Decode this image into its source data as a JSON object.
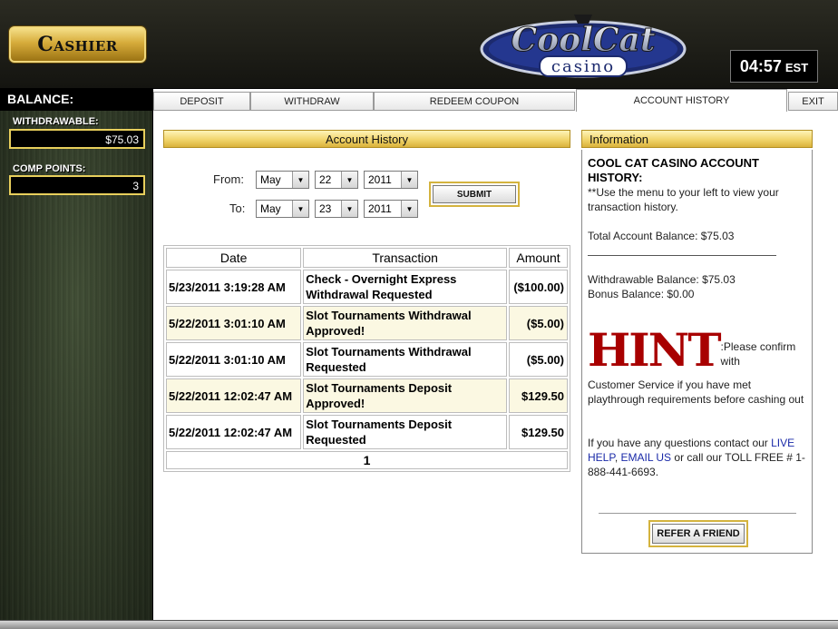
{
  "header": {
    "cashier_label": "Cashier",
    "brand_top": "CoolCat",
    "brand_bottom": "casino",
    "clock_time": "04:57",
    "clock_zone": "EST"
  },
  "sidebar": {
    "balance_label": "BALANCE:",
    "withdrawable_label": "WITHDRAWABLE:",
    "withdrawable_value": "$75.03",
    "comp_points_label": "COMP POINTS:",
    "comp_points_value": "3"
  },
  "tabs": [
    {
      "label": "DEPOSIT"
    },
    {
      "label": "WITHDRAW"
    },
    {
      "label": "REDEEM COUPON"
    },
    {
      "label": "ACCOUNT HISTORY",
      "active": true
    },
    {
      "label": "EXIT"
    }
  ],
  "history": {
    "title": "Account History",
    "from_label": "From:",
    "to_label": "To:",
    "from": {
      "month": "May",
      "day": "22",
      "year": "2011"
    },
    "to": {
      "month": "May",
      "day": "23",
      "year": "2011"
    },
    "submit_label": "SUBMIT",
    "columns": [
      "Date",
      "Transaction",
      "Amount"
    ],
    "rows": [
      {
        "date": "5/23/2011 3:19:28 AM",
        "transaction_l1": "Check - Overnight Express",
        "transaction_l2": "Withdrawal Requested",
        "amount": "($100.00)"
      },
      {
        "date": "5/22/2011 3:01:10 AM",
        "transaction_l1": "Slot Tournaments Withdrawal",
        "transaction_l2": "Approved!",
        "amount": "($5.00)"
      },
      {
        "date": "5/22/2011 3:01:10 AM",
        "transaction_l1": "Slot Tournaments Withdrawal",
        "transaction_l2": "Requested",
        "amount": "($5.00)"
      },
      {
        "date": "5/22/2011 12:02:47 AM",
        "transaction_l1": "Slot Tournaments Deposit",
        "transaction_l2": "Approved!",
        "amount": "$129.50"
      },
      {
        "date": "5/22/2011 12:02:47 AM",
        "transaction_l1": "Slot Tournaments Deposit",
        "transaction_l2": "Requested",
        "amount": "$129.50"
      }
    ],
    "page": "1"
  },
  "info": {
    "title": "Information",
    "heading": "COOL CAT CASINO ACCOUNT HISTORY:",
    "menu_note": "**Use the menu to your left to view your transaction history.",
    "total_balance": "Total Account Balance: $75.03",
    "withdrawable_balance": "Withdrawable Balance: $75.03",
    "bonus_balance": "Bonus Balance: $0.00",
    "hint_word": "HINT",
    "hint_text_1": ":Please confirm with",
    "hint_text_2": "Customer Service if you have met playthrough requirements before cashing out",
    "contact_prefix": "If you have any questions contact our ",
    "live_help": "LIVE HELP",
    "comma": ", ",
    "email_us": "EMAIL US",
    "contact_suffix": " or call our TOLL FREE # 1-888-441-6693.",
    "refer_label": "REFER A FRIEND"
  }
}
